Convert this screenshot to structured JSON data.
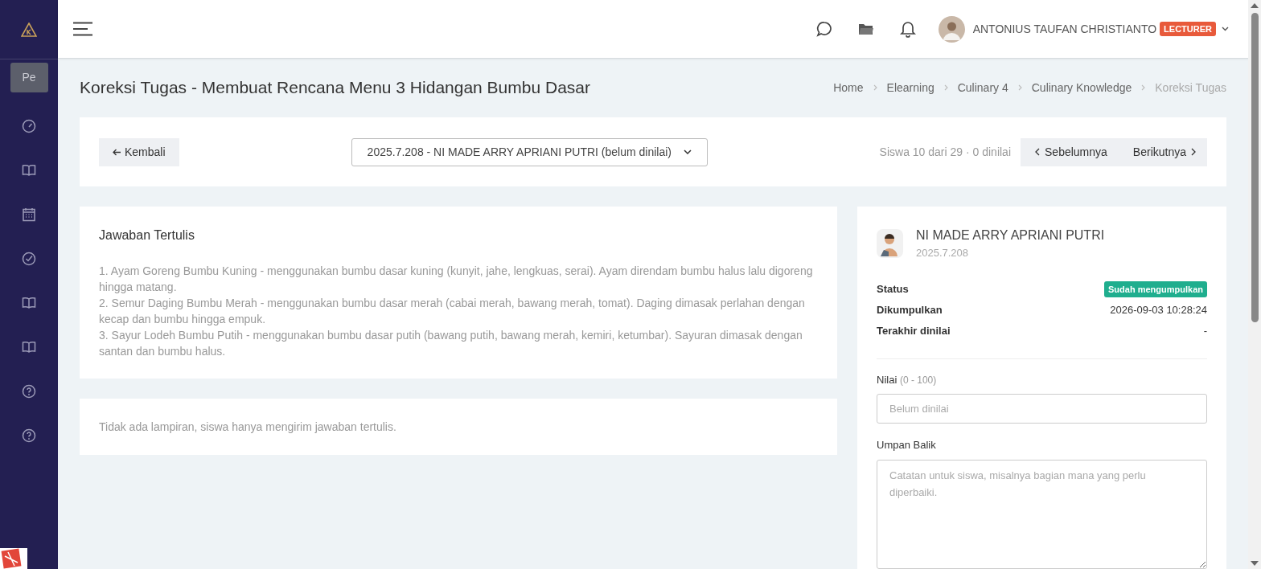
{
  "sidebar": {
    "items": [
      {
        "kind": "text",
        "label": "Pe",
        "selected": true
      },
      {
        "kind": "gauge",
        "selected": false
      },
      {
        "kind": "book",
        "selected": false
      },
      {
        "kind": "calendar",
        "selected": false
      },
      {
        "kind": "check",
        "selected": false
      },
      {
        "kind": "book",
        "selected": false
      },
      {
        "kind": "book",
        "selected": false
      },
      {
        "kind": "help",
        "selected": false
      },
      {
        "kind": "help",
        "selected": false
      }
    ]
  },
  "header": {
    "user": {
      "name": "ANTONIUS TAUFAN CHRISTIANTO",
      "role": "LECTURER"
    }
  },
  "page": {
    "title": "Koreksi Tugas - Membuat Rencana Menu 3 Hidangan Bumbu Dasar",
    "breadcrumb": [
      {
        "label": "Home",
        "current": false
      },
      {
        "label": "Elearning",
        "current": false
      },
      {
        "label": "Culinary 4",
        "current": false
      },
      {
        "label": "Culinary Knowledge",
        "current": false
      },
      {
        "label": "Koreksi Tugas",
        "current": true
      }
    ]
  },
  "toolbar": {
    "back": "Kembali",
    "student_select": "2025.7.208 - NI MADE ARRY APRIANI PUTRI (belum dinilai)",
    "progress": "Siswa 10 dari 29 · 0 dinilai",
    "prev": "Sebelumnya",
    "next": "Berikutnya"
  },
  "answer": {
    "title": "Jawaban Tertulis",
    "lines": [
      "1. Ayam Goreng Bumbu Kuning - menggunakan bumbu dasar kuning (kunyit, jahe, lengkuas, serai). Ayam direndam bumbu halus lalu digoreng hingga matang.",
      "2. Semur Daging Bumbu Merah - menggunakan bumbu dasar merah (cabai merah, bawang merah, tomat). Daging dimasak perlahan dengan kecap dan bumbu hingga empuk.",
      "3. Sayur Lodeh Bumbu Putih - menggunakan bumbu dasar putih (bawang putih, bawang merah, kemiri, ketumbar). Sayuran dimasak dengan santan dan bumbu halus."
    ]
  },
  "attachments": {
    "note": "Tidak ada lampiran, siswa hanya mengirim jawaban tertulis."
  },
  "grading": {
    "student": {
      "name": "NI MADE ARRY APRIANI PUTRI",
      "id": "2025.7.208"
    },
    "details": [
      {
        "label": "Status",
        "value": "Sudah mengumpulkan",
        "kind": "badge"
      },
      {
        "label": "Dikumpulkan",
        "value": "2026-09-03 10:28:24",
        "kind": "text"
      },
      {
        "label": "Terakhir dinilai",
        "value": "-",
        "kind": "text"
      }
    ],
    "score": {
      "label": "Nilai",
      "hint": "(0 - 100)",
      "placeholder": "Belum dinilai"
    },
    "feedback": {
      "label": "Umpan Balik",
      "placeholder": "Catatan untuk siswa, misalnya bagian mana yang perlu diperbaiki."
    }
  }
}
